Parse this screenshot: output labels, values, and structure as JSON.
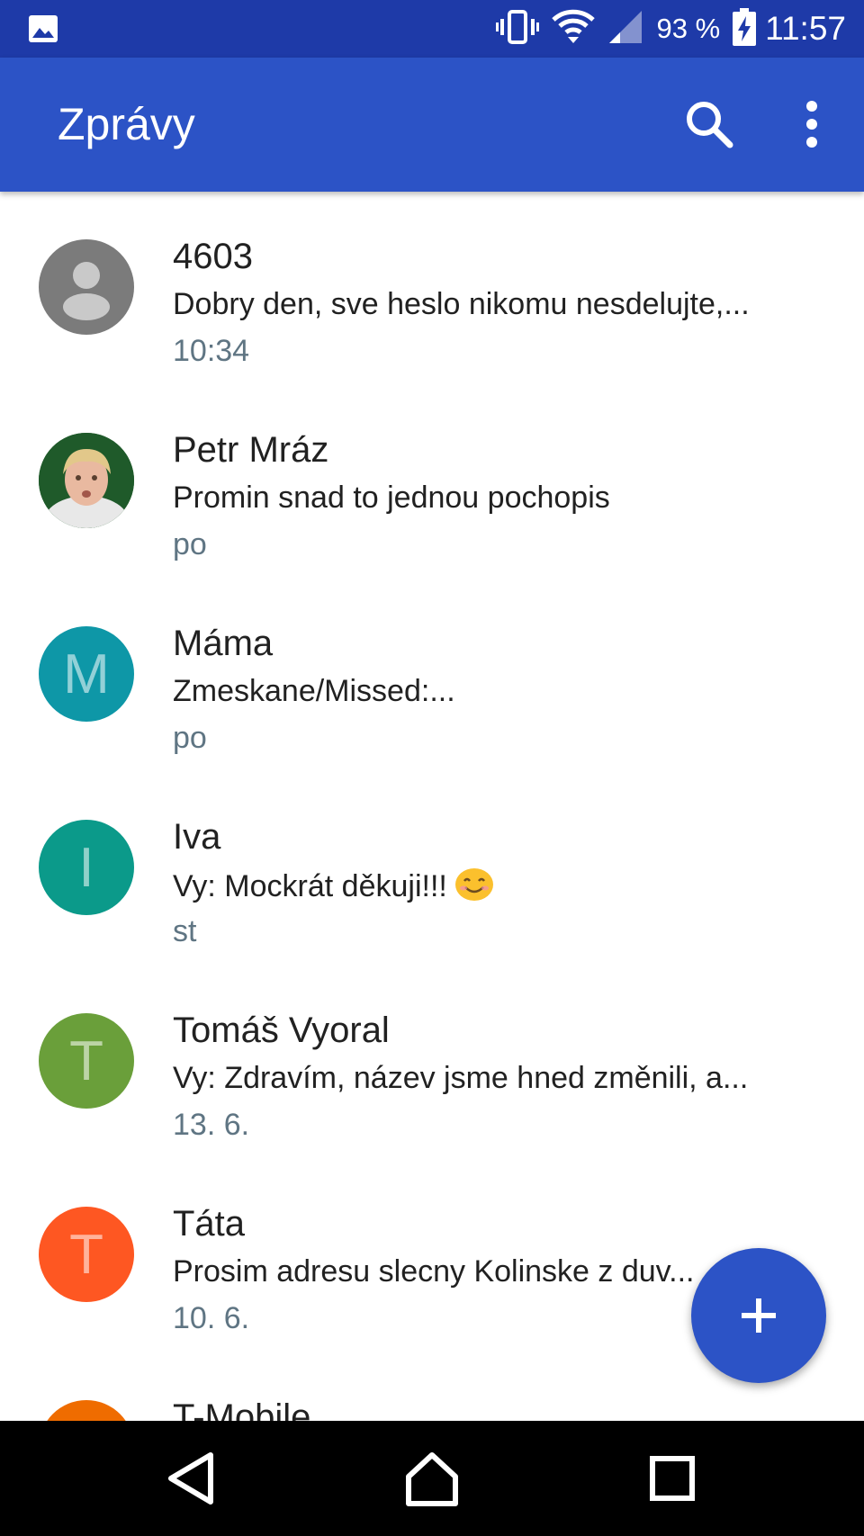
{
  "status_bar": {
    "battery": "93 %",
    "time": "11:57",
    "icons": [
      "image-notification-icon",
      "vibrate-icon",
      "wifi-icon",
      "signal-icon",
      "battery-charging-icon"
    ]
  },
  "app_bar": {
    "title": "Zprávy",
    "icons": [
      "search-icon",
      "more-vertical-icon"
    ]
  },
  "conversations": [
    {
      "name": "4603",
      "snippet": "Dobry den, sve heslo nikomu nesdelujte,...",
      "time": "10:34",
      "avatar": "person-placeholder",
      "color": "#7b7b7b"
    },
    {
      "name": "Petr Mráz",
      "snippet": "Promin snad to jednou pochopis",
      "time": "po",
      "avatar": "photo",
      "color": "#1f5a2a"
    },
    {
      "name": "Máma",
      "snippet": "Zmeskane/Missed:...",
      "time": "po",
      "avatar": "M",
      "color": "#0e97a7"
    },
    {
      "name": "Iva",
      "snippet": "Vy: Mockrát děkuji!!!",
      "time": "st",
      "avatar": "I",
      "color": "#0b9a8a",
      "emoji": "smiling-face-icon"
    },
    {
      "name": "Tomáš Vyoral",
      "snippet": "Vy: Zdravím, název jsme hned změnili, a...",
      "time": "13. 6.",
      "avatar": "T",
      "color": "#6a9f3a"
    },
    {
      "name": "Táta",
      "snippet": "Prosim adresu slecny Kolinske z duv...",
      "time": "10. 6.",
      "avatar": "T",
      "color": "#fe5722"
    },
    {
      "name": "T-Mobile",
      "snippet": "",
      "time": "",
      "avatar": "",
      "color": "#ef6c00"
    }
  ],
  "fab": {
    "icon": "plus-icon",
    "color": "#2c53c6"
  },
  "nav_bar": {
    "icons": [
      "back-icon",
      "home-icon",
      "recents-icon"
    ]
  },
  "colors": {
    "status_bar": "#1e3aa8",
    "app_bar": "#2c53c6",
    "time_text": "#5f7583"
  }
}
